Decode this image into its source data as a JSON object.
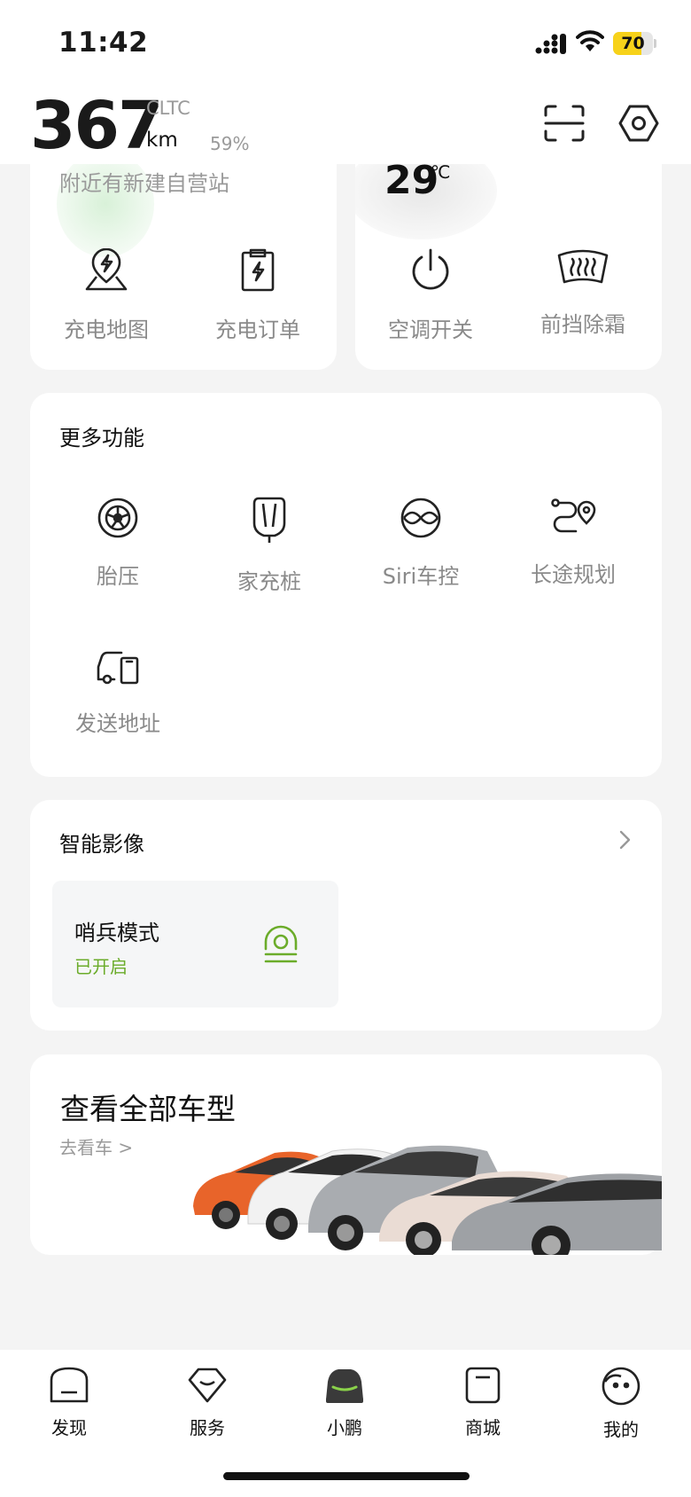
{
  "status_bar": {
    "time": "11:42",
    "battery_percent": 70,
    "battery_label": "70",
    "icons": [
      "signal-icon",
      "wifi-icon",
      "battery-icon"
    ]
  },
  "header": {
    "range_value": "367",
    "range_standard": "CLTC",
    "range_unit": "km",
    "soc": "59%",
    "icons": [
      "scan-icon",
      "settings-hex-icon"
    ]
  },
  "charging_card": {
    "subtitle": "附近有新建自营站",
    "actions": [
      {
        "label": "充电地图",
        "icon": "charge-map-icon"
      },
      {
        "label": "充电订单",
        "icon": "charge-order-icon"
      }
    ]
  },
  "climate_card": {
    "temperature": "29",
    "temperature_unit": "℃",
    "actions": [
      {
        "label": "空调开关",
        "icon": "power-icon"
      },
      {
        "label": "前挡除霜",
        "icon": "defrost-icon"
      }
    ]
  },
  "more_functions": {
    "title": "更多功能",
    "items": [
      {
        "label": "胎压",
        "icon": "tire-icon"
      },
      {
        "label": "家充桩",
        "icon": "home-charger-icon"
      },
      {
        "label": "Siri车控",
        "icon": "siri-icon"
      },
      {
        "label": "长途规划",
        "icon": "route-icon"
      },
      {
        "label": "发送地址",
        "icon": "send-address-icon"
      }
    ]
  },
  "smart_video": {
    "title": "智能影像",
    "sentry_title": "哨兵模式",
    "sentry_status": "已开启",
    "accent_color": "#6bac2a"
  },
  "models": {
    "title": "查看全部车型",
    "link_text": "去看车 >"
  },
  "tab_bar": {
    "tabs": [
      {
        "label": "发现",
        "icon": "discover-icon"
      },
      {
        "label": "服务",
        "icon": "service-icon"
      },
      {
        "label": "小鹏",
        "icon": "car-icon",
        "active": true
      },
      {
        "label": "商城",
        "icon": "mall-icon"
      },
      {
        "label": "我的",
        "icon": "profile-icon"
      }
    ]
  }
}
